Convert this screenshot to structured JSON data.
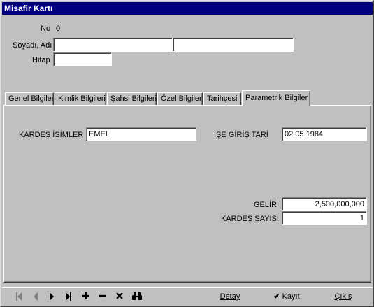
{
  "window": {
    "title": "Misafir Kartı"
  },
  "header": {
    "no_label": "No",
    "no_value": "0",
    "surname_label": "Soyadı, Adı",
    "surname_value": "",
    "name_value": "",
    "title_label": "Hitap",
    "title_value": ""
  },
  "tabs": [
    {
      "label": "Genel Bilgiler"
    },
    {
      "label": "Kimlik Bilgileri"
    },
    {
      "label": "Şahsi Bilgileri"
    },
    {
      "label": "Özel Bilgiler"
    },
    {
      "label": "Tarihçesi"
    },
    {
      "label": "Parametrik Bilgiler"
    }
  ],
  "active_tab": "Parametrik Bilgiler",
  "panel": {
    "siblings_label": "KARDEŞ İSİMLER",
    "siblings_value": "EMEL",
    "start_date_label": "İŞE GİRİŞ TARİ",
    "start_date_value": "02.05.1984",
    "income_label": "GELİRİ",
    "income_value": "2,500,000,000",
    "sibling_count_label": "KARDEŞ SAYISI",
    "sibling_count_value": "1"
  },
  "toolbar": {
    "nav_icons": [
      "first-record-icon",
      "prior-record-icon",
      "next-record-icon",
      "last-record-icon",
      "insert-icon",
      "delete-icon",
      "cancel-icon",
      "search-binoculars-icon"
    ],
    "detail_label": "Detay",
    "save_label": "Kayıt",
    "exit_label": "Çıkış"
  },
  "colors": {
    "titlebar": "#000080",
    "face": "#c0c0c0",
    "field": "#ffffff"
  }
}
